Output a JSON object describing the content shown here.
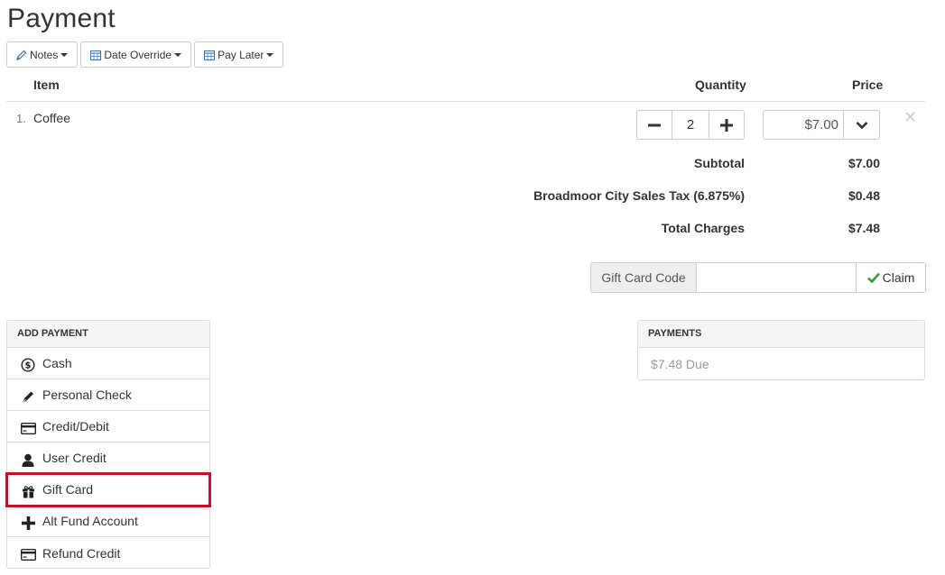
{
  "page": {
    "title": "Payment"
  },
  "toolbar": {
    "notes_label": "Notes",
    "date_override_label": "Date Override",
    "pay_later_label": "Pay Later"
  },
  "table": {
    "headers": {
      "item": "Item",
      "quantity": "Quantity",
      "price": "Price"
    },
    "rows": [
      {
        "number": "1.",
        "item": "Coffee",
        "quantity": "2",
        "price": "$7.00"
      }
    ]
  },
  "summary": {
    "subtotal_label": "Subtotal",
    "subtotal_value": "$7.00",
    "tax_label": "Broadmoor City Sales Tax (6.875%)",
    "tax_value": "$0.48",
    "total_label": "Total Charges",
    "total_value": "$7.48"
  },
  "gift_card": {
    "addon_label": "Gift Card Code",
    "input_value": "",
    "claim_label": "Claim"
  },
  "add_payment": {
    "heading": "ADD PAYMENT",
    "items": [
      {
        "label": "Cash",
        "icon": "dollar-circle-icon"
      },
      {
        "label": "Personal Check",
        "icon": "pen-icon"
      },
      {
        "label": "Credit/Debit",
        "icon": "credit-card-icon"
      },
      {
        "label": "User Credit",
        "icon": "user-icon"
      },
      {
        "label": "Gift Card",
        "icon": "gift-icon",
        "highlighted": true
      },
      {
        "label": "Alt Fund Account",
        "icon": "plus-icon"
      },
      {
        "label": "Refund Credit",
        "icon": "credit-card-icon"
      }
    ]
  },
  "payments": {
    "heading": "PAYMENTS",
    "due_text": "$7.48 Due"
  },
  "colors": {
    "highlight_border": "#c0142f",
    "claim_check": "#3c9a3c",
    "icon_blue": "#3a6ea5"
  }
}
